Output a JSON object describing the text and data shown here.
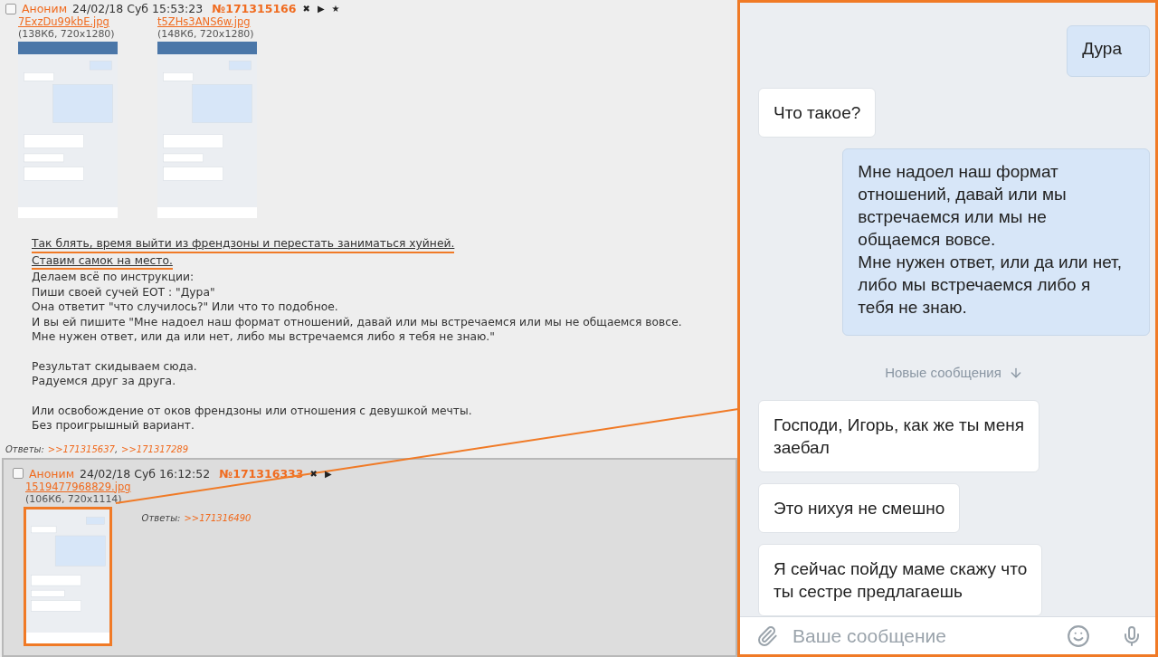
{
  "thread": [
    {
      "checked": false,
      "name": "Аноним",
      "date": "24/02/18 Суб 15:53:23",
      "number": "№171315166",
      "actions": [
        "✖",
        "▶",
        "★"
      ],
      "files": [
        {
          "name": "7ExzDu99kbE.jpg",
          "info": "(138Кб, 720x1280)",
          "highlighted": false
        },
        {
          "name": "t5ZHs3ANS6w.jpg",
          "info": "(148Кб, 720x1280)",
          "highlighted": false
        }
      ],
      "paragraphs": [
        {
          "lines": [
            {
              "text": "Так блять, время выйти из френдзоны и перестать заниматься хуйней.",
              "highlighted": true
            },
            {
              "text": "Ставим самок на место.",
              "highlighted": true
            },
            {
              "text": "Делаем всё по инструкции:",
              "highlighted": false
            },
            {
              "text": "Пиши своей сучей ЕОТ : \"Дура\"",
              "highlighted": false
            },
            {
              "text": "Она ответит \"что случилось?\" Или что то подобное.",
              "highlighted": false
            },
            {
              "text": "И вы ей пишите \"Мне надоел наш формат отношений, давай или мы встречаемся или мы не общаемся вовсе.",
              "highlighted": false
            },
            {
              "text": "Мне нужен ответ, или да или нет, либо мы встречаемся либо я тебя не знаю.\"",
              "highlighted": false
            }
          ]
        },
        {
          "lines": [
            {
              "text": "Результат скидываем сюда.",
              "highlighted": false
            },
            {
              "text": "Радуемся друг за друга.",
              "highlighted": false
            }
          ]
        },
        {
          "lines": [
            {
              "text": "Или освобождение от оков френдзоны или отношения с девушкой мечты.",
              "highlighted": false
            },
            {
              "text": "Без проигрышный вариант.",
              "highlighted": false
            }
          ]
        }
      ],
      "replies_label": "Ответы:",
      "replies": [
        ">>171315637",
        ">>171317289"
      ],
      "replies_separator": ","
    },
    {
      "checked": false,
      "name": "Аноним",
      "date": "24/02/18 Суб 16:12:52",
      "number": "№171316333",
      "actions": [
        "✖",
        "▶"
      ],
      "files": [
        {
          "name": "1519477968829.jpg",
          "info": "(106Кб, 720x1114)",
          "highlighted": true
        }
      ],
      "replies_label": "Ответы:",
      "replies": [
        ">>171316490"
      ]
    }
  ],
  "chat": {
    "messages": [
      {
        "kind": "outgoing",
        "text": "Дура"
      },
      {
        "kind": "incoming",
        "text": "Что такое?"
      },
      {
        "kind": "outgoing",
        "text": "Мне надоел наш формат\nотношений, давай или мы\nвстречаемся или мы не\nобщаемся вовсе.\nМне нужен ответ, или да или нет,\nлибо мы встречаемся либо я\nтебя не знаю."
      },
      {
        "kind": "divider",
        "text": "Новые сообщения"
      },
      {
        "kind": "incoming",
        "text": "Господи, Игорь, как же ты меня\nзаебал"
      },
      {
        "kind": "incoming",
        "text": "Это нихуя не смешно"
      },
      {
        "kind": "incoming",
        "text": "Я сейчас пойду маме скажу что\nты сестре предлагаешь"
      }
    ],
    "input": {
      "placeholder": "Ваше сообщение"
    }
  }
}
